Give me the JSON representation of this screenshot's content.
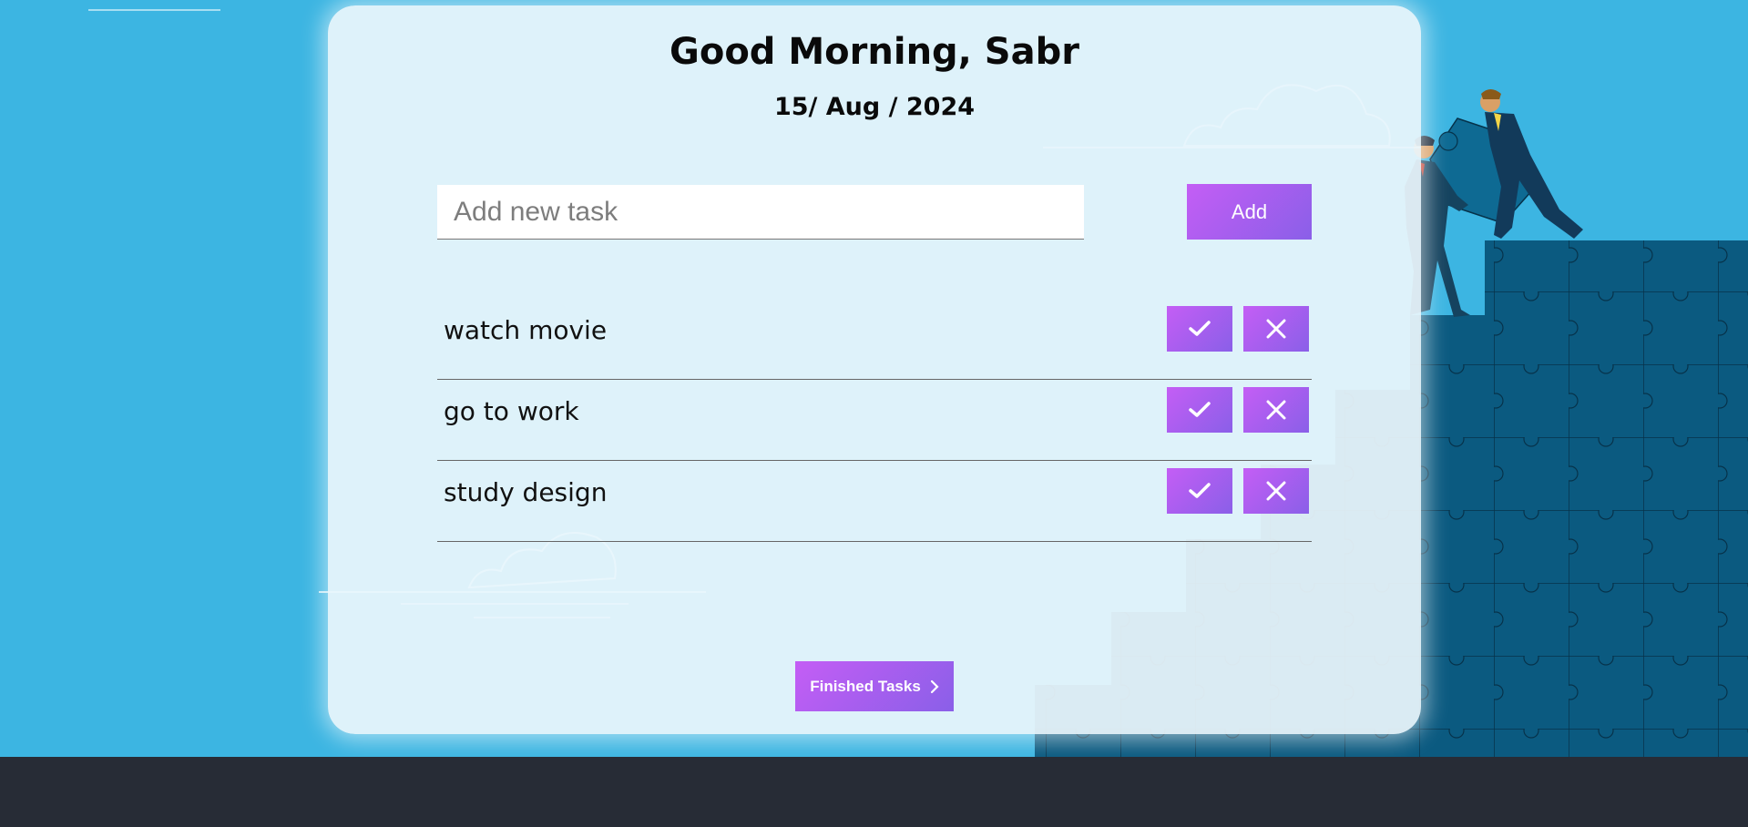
{
  "header": {
    "greeting": "Good Morning, Sabr",
    "date": "15/ Aug / 2024"
  },
  "new_task": {
    "placeholder": "Add new task",
    "value": "",
    "add_label": "Add"
  },
  "tasks": [
    {
      "text": "watch movie"
    },
    {
      "text": "go to work"
    },
    {
      "text": "study design"
    }
  ],
  "finished_button": {
    "label": "Finished Tasks",
    "icon": "chevron-right-icon"
  },
  "icons": {
    "complete": "check-icon",
    "delete": "close-icon"
  },
  "colors": {
    "background": "#3cb5e2",
    "card": "#ebf6fc",
    "button_gradient_start": "#c45ef5",
    "button_gradient_end": "#8a5fe8",
    "puzzle": "#0a5a80",
    "footer": "#272c36"
  }
}
